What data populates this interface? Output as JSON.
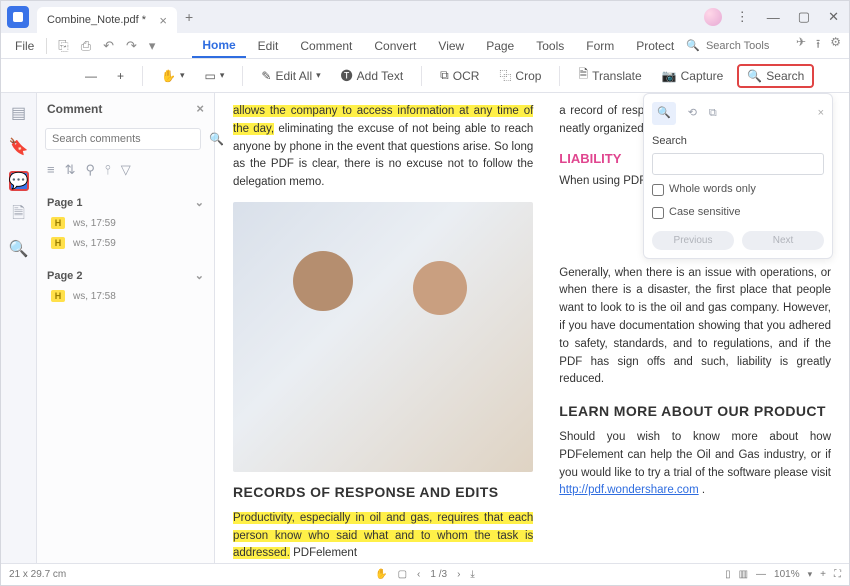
{
  "titlebar": {
    "tab_name": "Combine_Note.pdf *"
  },
  "menubar": {
    "file": "File",
    "items": [
      "Home",
      "Edit",
      "Comment",
      "Convert",
      "View",
      "Page",
      "Tools",
      "Form",
      "Protect"
    ],
    "active": 0,
    "search_tools_placeholder": "Search Tools"
  },
  "toolbar": {
    "edit_all": "Edit All",
    "add_text": "Add Text",
    "ocr": "OCR",
    "crop": "Crop",
    "translate": "Translate",
    "capture": "Capture",
    "search": "Search"
  },
  "sidebar": {
    "title": "Comment",
    "search_placeholder": "Search comments",
    "pages": [
      {
        "label": "Page 1",
        "items": [
          {
            "tag": "H",
            "text": "ws, 17:59"
          },
          {
            "tag": "H",
            "text": "ws, 17:59"
          }
        ]
      },
      {
        "label": "Page 2",
        "items": [
          {
            "tag": "H",
            "text": "ws, 17:58"
          }
        ]
      }
    ]
  },
  "doc": {
    "left_intro_hl": "allows the company to access information at any time of the day,",
    "left_intro_rest": " eliminating the excuse of not being able to reach anyone by phone in the event that questions arise. So long as the PDF is clear, there is no excuse not to follow the delegation memo.",
    "records_heading": "RECORDS OF RESPONSE AND EDITS",
    "records_hl": "Productivity, especially in oil and gas, requires that each person know who said what and to whom the task is addressed.",
    "records_tail": " PDFelement",
    "right_top": "a record of responses and edits, and such are kept neatly organized in PDFelement.",
    "liability": "LIABILITY",
    "liability_line": "When using PDFelement documents",
    "right_mid": "Generally, when there is an issue with operations, or when there is a disaster, the first place that people want to look to is the oil and gas company. However, if you have documentation showing that you adhered to safety, standards, and to regulations, and if the PDF has sign offs and such, liability is greatly reduced.",
    "learn_heading": "LEARN MORE ABOUT OUR PRODUCT",
    "learn_body1": "Should you wish to know more about how PDFelement can help the Oil and Gas industry, or if you would like to try a trial of the software please visit ",
    "learn_url": "http://pdf.wondershare.com"
  },
  "search_panel": {
    "label": "Search",
    "whole_words": "Whole words only",
    "case_sensitive": "Case sensitive",
    "previous": "Previous",
    "next": "Next"
  },
  "statusbar": {
    "dims": "21 x 29.7 cm",
    "page_current": "1",
    "page_total": "/3",
    "zoom": "101%"
  }
}
